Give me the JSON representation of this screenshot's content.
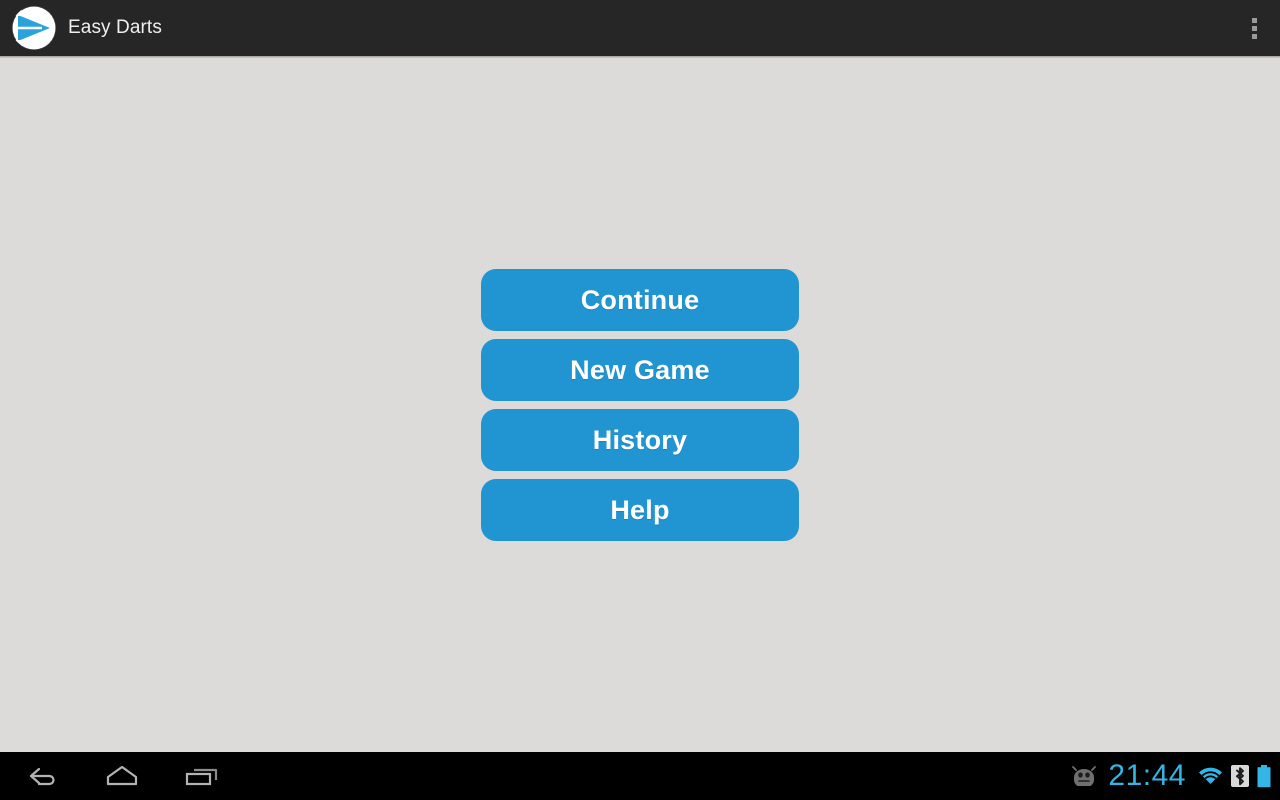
{
  "app": {
    "title": "Easy Darts",
    "icon_name": "easy-darts-logo",
    "accent_color": "#2194d2",
    "background_color": "#dcdbd9",
    "action_bar_color": "#262626"
  },
  "action_bar": {
    "overflow_label": "More options",
    "overflow_icon": "overflow-menu-icon"
  },
  "main_menu": {
    "buttons": [
      {
        "label": "Continue",
        "name": "continue-button"
      },
      {
        "label": "New Game",
        "name": "new-game-button"
      },
      {
        "label": "History",
        "name": "history-button"
      },
      {
        "label": "Help",
        "name": "help-button"
      }
    ]
  },
  "system_nav": {
    "back_icon": "back-icon",
    "home_icon": "home-icon",
    "recents_icon": "recents-icon",
    "status": {
      "debug_icon": "android-debug-icon",
      "clock": "21:44",
      "clock_color": "#33b5e5",
      "wifi_icon": "wifi-icon",
      "bluetooth_icon": "bluetooth-icon",
      "battery_icon": "battery-icon"
    }
  }
}
